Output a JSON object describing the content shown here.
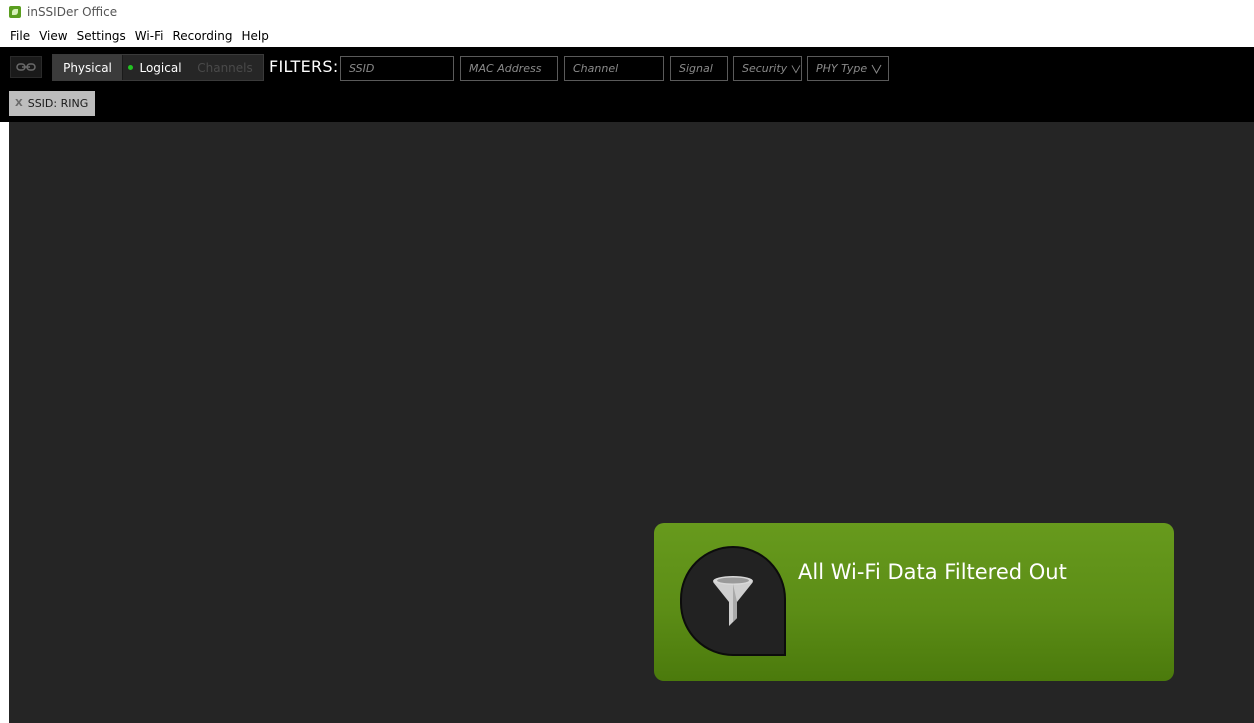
{
  "window": {
    "title": "inSSIDer Office"
  },
  "menu": {
    "items": [
      "File",
      "View",
      "Settings",
      "Wi-Fi",
      "Recording",
      "Help"
    ]
  },
  "toolbar": {
    "link_icon": "link-icon",
    "views": {
      "physical": "Physical",
      "logical": "Logical",
      "channels": "Channels"
    },
    "filters_label": "FILTERS:",
    "filters": {
      "ssid": "SSID",
      "mac": "MAC Address",
      "channel": "Channel",
      "signal": "Signal",
      "security": "Security",
      "phy_type": "PHY Type"
    }
  },
  "active_filters": [
    {
      "close": "X",
      "label": "SSID: RING"
    }
  ],
  "notice": {
    "icon": "funnel-icon",
    "text": "All Wi-Fi Data Filtered Out"
  },
  "colors": {
    "toolbar_bg": "#000000",
    "main_bg": "#252525",
    "notice_green": "#5c8d16",
    "status_dot": "#22c222"
  }
}
